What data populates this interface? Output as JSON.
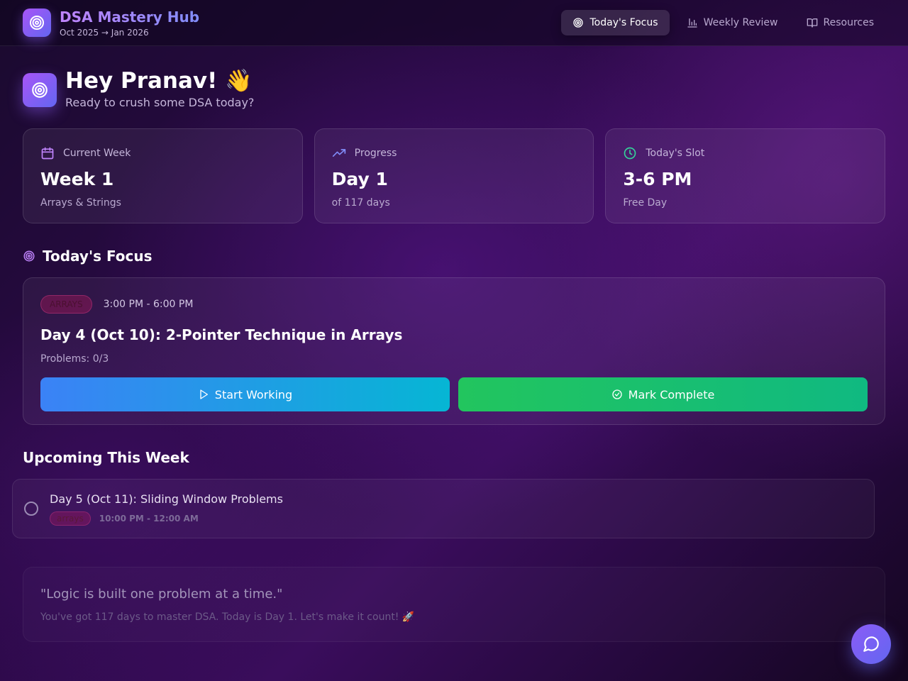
{
  "app": {
    "title": "DSA Mastery Hub",
    "date_range": "Oct 2025 → Jan 2026",
    "logo_icon": "target-icon"
  },
  "nav": {
    "tabs": [
      {
        "label": "Today's Focus",
        "icon": "target-icon",
        "active": true
      },
      {
        "label": "Weekly Review",
        "icon": "bar-chart-icon",
        "active": false
      },
      {
        "label": "Resources",
        "icon": "book-open-icon",
        "active": false
      }
    ]
  },
  "greeting": {
    "title": "Hey Pranav! 👋",
    "subtitle": "Ready to crush some DSA today?"
  },
  "stats": [
    {
      "label": "Current Week",
      "icon": "calendar-icon",
      "value": "Week 1",
      "detail": "Arrays & Strings"
    },
    {
      "label": "Progress",
      "icon": "trending-up-icon",
      "value": "Day 1",
      "detail": "of 117 days"
    },
    {
      "label": "Today's Slot",
      "icon": "clock-icon",
      "value": "3-6 PM",
      "detail": "Free Day"
    }
  ],
  "focus": {
    "section_title": "Today's Focus",
    "tag": "ARRAYS",
    "time": "3:00 PM - 6:00 PM",
    "title": "Day 4 (Oct 10): 2-Pointer Technique in Arrays",
    "problems": "Problems: 0/3",
    "start_label": "Start Working",
    "complete_label": "Mark Complete"
  },
  "upcoming": {
    "section_title": "Upcoming This Week",
    "items": [
      {
        "title": "Day 5 (Oct 11): Sliding Window Problems",
        "tag": "arrays",
        "time": "10:00 PM - 12:00 AM"
      }
    ]
  },
  "quote": {
    "text": "\"Logic is built one problem at a time.\"",
    "sub": "You've got 117 days to master DSA. Today is Day 1. Let's make it count! 🚀"
  },
  "colors": {
    "accent_purple": "#a855f7",
    "accent_indigo": "#6366f1",
    "start_blue": "#3b82f6",
    "complete_green": "#22c55e",
    "calendar_icon": "#c084fc",
    "progress_icon": "#818cf8",
    "clock_icon": "#34d399"
  },
  "fab": {
    "icon": "chat-bubble-icon"
  }
}
